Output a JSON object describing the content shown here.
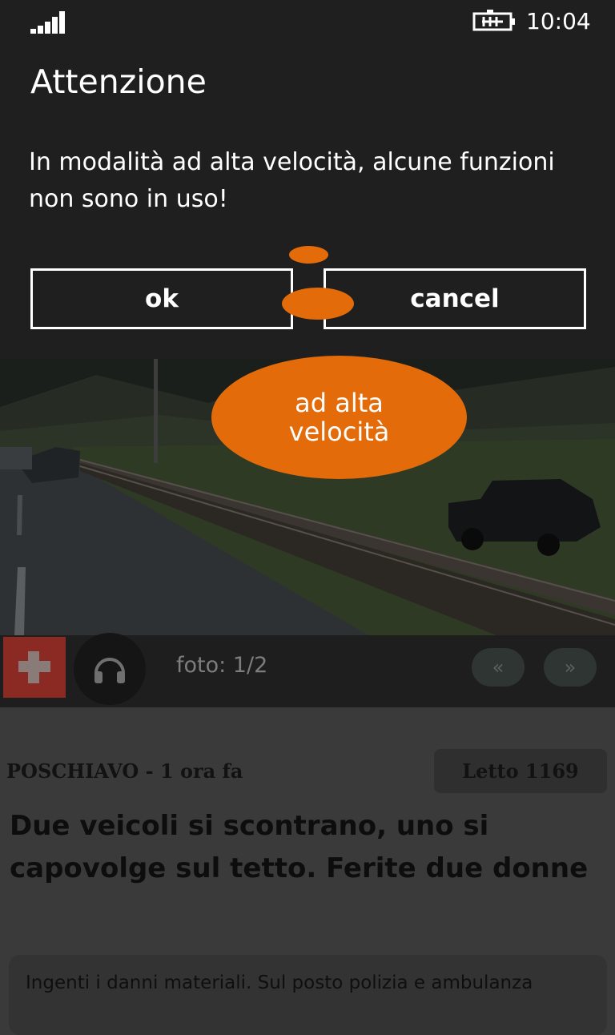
{
  "status_bar": {
    "signal_icon": "signal-bars-icon",
    "battery_icon": "battery-charging-icon",
    "time": "10:04"
  },
  "dialog": {
    "title": "Attenzione",
    "message": "In modalità ad alta velocità, alcune funzioni non sono in uso!",
    "ok_label": "ok",
    "cancel_label": "cancel"
  },
  "callout": {
    "text": "ad alta velocità",
    "color": "#e36b0a"
  },
  "toolbar": {
    "flag_icon": "swiss-flag-icon",
    "audio_icon": "headphones-icon",
    "photo_counter": "foto: 1/2",
    "prev_label": "«",
    "next_label": "»"
  },
  "article": {
    "meta": "POSCHIAVO - 1 ora fa",
    "reads": "Letto 1169",
    "headline": "Due veicoli si scontrano, uno si capovolge sul tetto. Ferite due donne",
    "summary": "Ingenti i danni materiali. Sul posto polizia e ambulanza"
  }
}
